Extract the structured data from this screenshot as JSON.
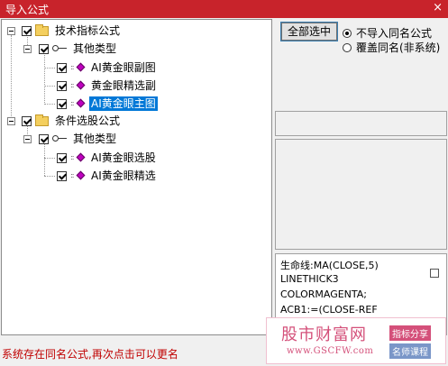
{
  "window": {
    "title": "导入公式",
    "close_glyph": "×"
  },
  "tree": {
    "groups": [
      {
        "label": "技术指标公式",
        "category": {
          "label": "其他类型",
          "items": [
            {
              "label": "AI黄金眼副图"
            },
            {
              "label": "黄金眼精选副"
            },
            {
              "label": "AI黄金眼主图",
              "selected": true
            }
          ]
        }
      },
      {
        "label": "条件选股公式",
        "category": {
          "label": "其他类型",
          "items": [
            {
              "label": "AI黄金眼选股"
            },
            {
              "label": "AI黄金眼精选"
            }
          ]
        }
      }
    ]
  },
  "options": {
    "select_all_label": "全部选中",
    "radio_no_import": "不导入同名公式",
    "radio_overwrite": "覆盖同名(非系统)",
    "selected_radio": "no_import"
  },
  "code_preview": {
    "lines": [
      "生命线:MA(CLOSE,5)",
      "LINETHICK3",
      "COLORMAGENTA;",
      "ACB1:=(CLOSE-REF"
    ]
  },
  "status_text": "系统存在同名公式,再次点击可以更名",
  "watermark": {
    "name": "股市财富网",
    "url": "www.GSCFW.com",
    "tag1": "指标分享",
    "tag2": "名师课程"
  },
  "colors": {
    "titlebar": "#c8232b",
    "selection": "#0078d7",
    "status": "#c00000"
  }
}
